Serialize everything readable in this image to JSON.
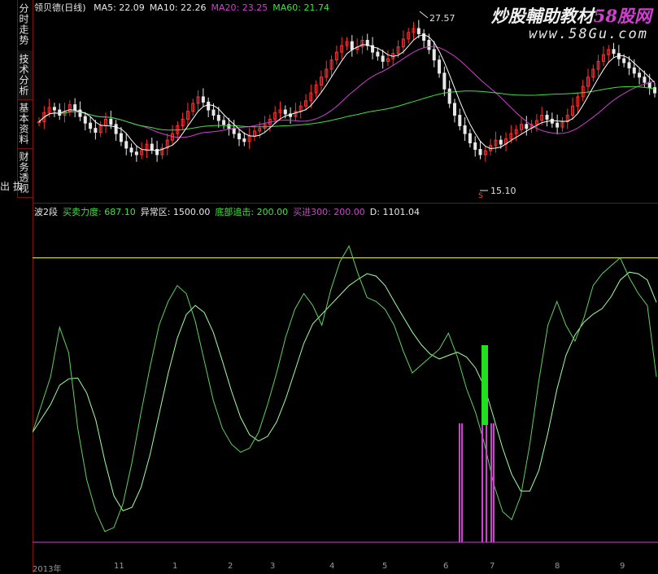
{
  "left_panel": {
    "tabs": [
      {
        "label": "分时走势"
      },
      {
        "label": "技术分析"
      },
      {
        "label": "基本资料"
      },
      {
        "label": "财务透视"
      }
    ],
    "side_label": "出 抜"
  },
  "upper_chart": {
    "title": "领贝德(日线)",
    "indicators": [
      {
        "label": "MA5: 22.09",
        "color": "#e8e8e8"
      },
      {
        "label": "MA10: 22.26",
        "color": "#e8e8e8"
      },
      {
        "label": "MA20: 23.25",
        "color": "#d040d0"
      },
      {
        "label": "MA60: 21.74",
        "color": "#40e040"
      }
    ],
    "high_annotation": "27.57",
    "low_annotation": "15.10",
    "low_marker": "S",
    "watermark_line1": "炒股輔助教材",
    "watermark_brand": "58股网",
    "watermark_line2": "www.58Gu.com"
  },
  "lower_chart": {
    "indicators": [
      {
        "label": "波2段",
        "color": "#e8e8e8"
      },
      {
        "label": "买卖力度: 687.10",
        "color": "#40e040"
      },
      {
        "label": "异常区: 1500.00",
        "color": "#e8e8e8"
      },
      {
        "label": "底部追击: 200.00",
        "color": "#40e040"
      },
      {
        "label": "买进300: 200.00",
        "color": "#d040d0"
      },
      {
        "label": "D: 1101.04",
        "color": "#e8e8e8"
      }
    ],
    "x_ticks": [
      "2013年",
      "11",
      "1",
      "2",
      "3",
      "4",
      "5",
      "6",
      "7",
      "8",
      "9"
    ]
  },
  "chart_data": {
    "type": "line",
    "colors": {
      "candle_up": "#ff3030",
      "candle_down": "#e8e8e8",
      "ma5": "#ffffff",
      "ma20": "#d040d0",
      "ma60": "#40e040",
      "fast_line": "#60d060",
      "slow_line": "#a0ffa0",
      "threshold_line": "#ffff80",
      "magenta_bars": "#d040d0",
      "green_bar": "#20e020"
    },
    "price_series": {
      "close": [
        20.1,
        20.8,
        21.2,
        21.0,
        20.6,
        20.9,
        21.4,
        21.0,
        20.5,
        20.0,
        19.6,
        19.3,
        19.8,
        20.3,
        19.9,
        19.2,
        18.6,
        18.1,
        17.8,
        17.6,
        17.9,
        18.4,
        18.0,
        17.6,
        18.1,
        18.7,
        19.2,
        19.8,
        20.3,
        20.9,
        21.5,
        22.0,
        21.6,
        21.0,
        20.6,
        20.2,
        19.9,
        19.6,
        19.2,
        18.8,
        18.6,
        19.0,
        19.4,
        19.6,
        19.9,
        20.3,
        20.8,
        21.0,
        20.7,
        20.5,
        20.9,
        21.3,
        21.7,
        22.3,
        22.9,
        23.5,
        24.1,
        24.8,
        25.4,
        25.9,
        26.2,
        25.6,
        25.8,
        26.3,
        25.9,
        25.4,
        25.1,
        24.7,
        24.9,
        25.3,
        25.8,
        26.4,
        26.9,
        27.2,
        26.8,
        26.3,
        25.6,
        24.8,
        23.8,
        22.6,
        21.5,
        20.6,
        19.8,
        19.2,
        18.5,
        18.0,
        17.6,
        17.9,
        18.3,
        18.7,
        18.4,
        18.8,
        19.2,
        19.5,
        19.9,
        19.6,
        19.9,
        20.2,
        20.6,
        20.3,
        20.0,
        19.7,
        20.1,
        20.6,
        21.3,
        22.0,
        22.8,
        23.5,
        24.1,
        24.7,
        25.2,
        25.6,
        25.3,
        24.9,
        24.6,
        24.2,
        23.8,
        23.5,
        23.1,
        22.7,
        22.3
      ]
    },
    "oscillator_series": {
      "fast": [
        620,
        760,
        900,
        1150,
        1020,
        640,
        380,
        220,
        120,
        140,
        260,
        470,
        720,
        950,
        1160,
        1280,
        1360,
        1320,
        1180,
        980,
        780,
        640,
        560,
        520,
        540,
        620,
        760,
        920,
        1100,
        1240,
        1320,
        1260,
        1160,
        1340,
        1480,
        1560,
        1420,
        1300,
        1280,
        1240,
        1160,
        1030,
        920,
        960,
        1000,
        1040,
        1120,
        1000,
        840,
        720,
        560,
        360,
        220,
        180,
        300,
        560,
        880,
        1160,
        1280,
        1160,
        1080,
        1200,
        1360,
        1420,
        1460,
        1500,
        1400,
        1320,
        1260,
        900
      ]
    },
    "threshold": 1500,
    "ylim": [
      0,
      1700
    ]
  }
}
